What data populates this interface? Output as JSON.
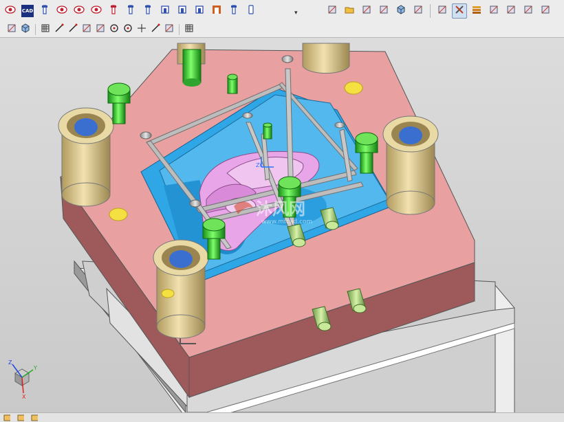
{
  "toolbar_top": {
    "left": [
      {
        "name": "feature-eye-icon",
        "color": "#c02030"
      },
      {
        "name": "cad-button",
        "label": "CAD"
      },
      {
        "name": "ejector-pin-icon",
        "color": "#3050b0"
      },
      {
        "name": "target-circle-icon",
        "color": "#c02030"
      },
      {
        "name": "target-ring-icon",
        "color": "#c02030"
      },
      {
        "name": "eye-target-icon",
        "color": "#c02030"
      },
      {
        "name": "pin-marker-icon",
        "color": "#c02030"
      },
      {
        "name": "sprue-icon",
        "color": "#3050b0"
      },
      {
        "name": "slider-pin-icon",
        "color": "#3050b0"
      },
      {
        "name": "lifter-icon",
        "color": "#3050b0"
      },
      {
        "name": "insert-icon",
        "color": "#3050b0"
      },
      {
        "name": "mold-base-icon",
        "color": "#3050b0"
      },
      {
        "name": "cooling-icon",
        "color": "#d06020"
      },
      {
        "name": "rod-icon",
        "color": "#3050b0"
      },
      {
        "name": "bolt-icon",
        "color": "#3050b0"
      }
    ],
    "right": [
      {
        "name": "assembly-tree-icon"
      },
      {
        "name": "open-folder-icon"
      },
      {
        "name": "wcs-icon"
      },
      {
        "name": "axis-icon"
      },
      {
        "name": "block-icon"
      },
      {
        "name": "plane-icon"
      },
      {
        "name": "sketch-icon"
      },
      {
        "name": "tools-icon"
      },
      {
        "name": "layers-icon"
      },
      {
        "name": "window-icon"
      },
      {
        "name": "measure-icon"
      },
      {
        "name": "datum-icon"
      },
      {
        "name": "render-icon"
      }
    ]
  },
  "toolbar_second": [
    {
      "name": "view-fit-icon"
    },
    {
      "name": "cube-view-icon"
    },
    {
      "name": "snap-grid-icon"
    },
    {
      "name": "line-tool-icon"
    },
    {
      "name": "line-pick-icon"
    },
    {
      "name": "curve-icon"
    },
    {
      "name": "tangent-icon"
    },
    {
      "name": "circle-center-icon"
    },
    {
      "name": "circle-icon"
    },
    {
      "name": "crosshair-icon"
    },
    {
      "name": "slash-icon"
    },
    {
      "name": "snap-point-icon"
    },
    {
      "name": "grid-pattern-icon"
    }
  ],
  "viewport": {
    "watermark_text": "沐风网",
    "watermark_sub": "www.mfcad.com",
    "triad": {
      "x": "X",
      "y": "Y",
      "z": "Z"
    },
    "colors": {
      "plate": "#e8a0a0",
      "plate_side": "#9e5a5a",
      "cavity": "#2fa6e6",
      "part": "#e8a6e8",
      "bushing": "#d9c490",
      "bolt": "#22bb22",
      "steel": "#b8b8b8"
    }
  },
  "statusbar": [
    {
      "name": "status-view-icon"
    },
    {
      "name": "status-layer-icon"
    },
    {
      "name": "status-part-icon"
    }
  ]
}
